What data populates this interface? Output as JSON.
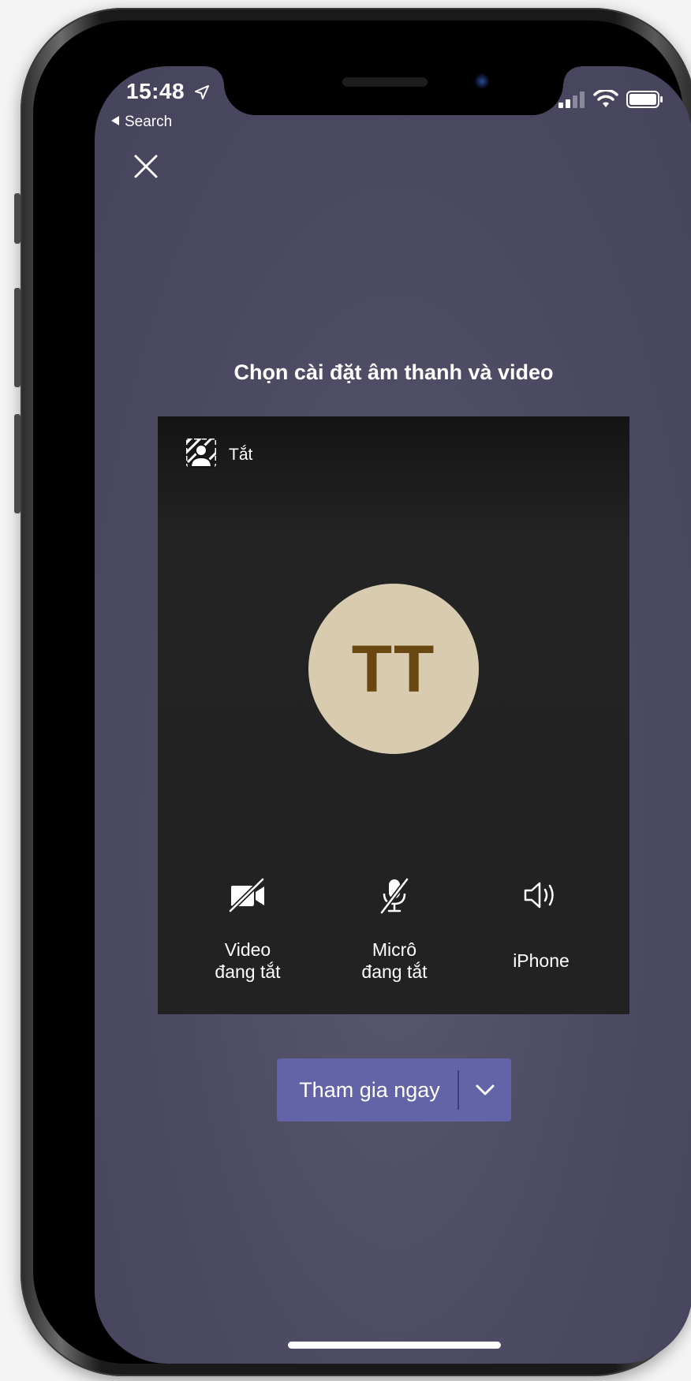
{
  "status_bar": {
    "time": "15:48",
    "back_label": "Search"
  },
  "prejoin": {
    "heading": "Chọn cài đặt âm thanh và video",
    "background_label": "Tắt",
    "avatar_initials": "TT",
    "controls": {
      "video_line1": "Video",
      "video_line2": "đang tắt",
      "mic_line1": "Micrô",
      "mic_line2": "đang tắt",
      "speaker": "iPhone"
    },
    "join_label": "Tham gia ngay"
  },
  "colors": {
    "screen_bg": "#4c4a62",
    "card_bg": "#222222",
    "avatar_bg": "#d8cbb0",
    "avatar_text": "#6a4710",
    "join_button": "#6264a7"
  },
  "icons": [
    "close-icon",
    "background-effects-icon",
    "video-off-icon",
    "mic-off-icon",
    "speaker-icon",
    "chevron-down-icon",
    "location-arrow-icon",
    "signal-icon",
    "wifi-icon",
    "battery-icon"
  ]
}
